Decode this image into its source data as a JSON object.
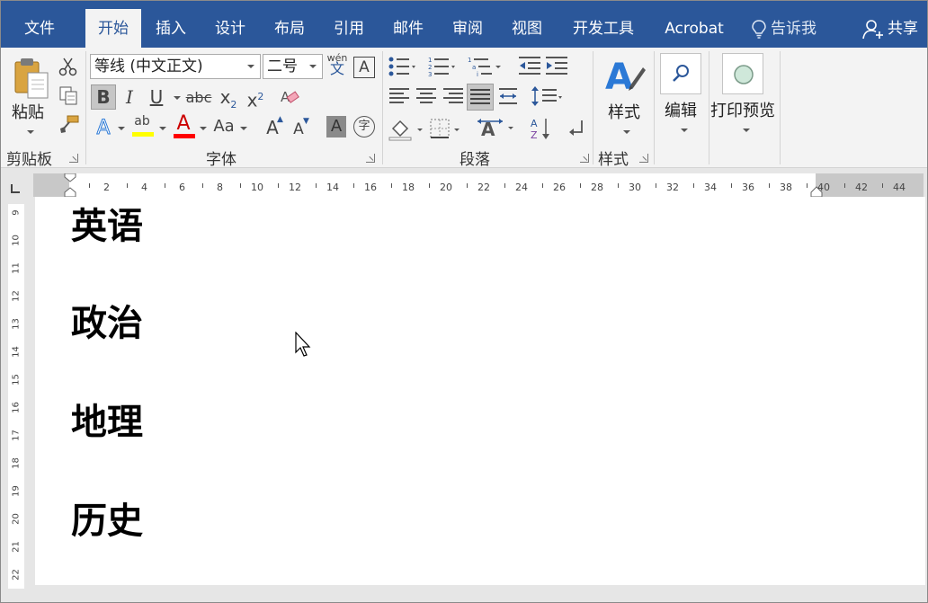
{
  "tabs": [
    {
      "label": "文件",
      "active": false
    },
    {
      "label": "开始",
      "active": true
    },
    {
      "label": "插入",
      "active": false
    },
    {
      "label": "设计",
      "active": false
    },
    {
      "label": "布局",
      "active": false
    },
    {
      "label": "引用",
      "active": false
    },
    {
      "label": "邮件",
      "active": false
    },
    {
      "label": "审阅",
      "active": false
    },
    {
      "label": "视图",
      "active": false
    },
    {
      "label": "开发工具",
      "active": false
    },
    {
      "label": "Acrobat",
      "active": false
    }
  ],
  "tell_me": "告诉我",
  "share": "共享",
  "clipboard": {
    "paste_label": "粘贴",
    "group_label": "剪贴板"
  },
  "font": {
    "font_name": "等线 (中文正文)",
    "font_size": "二号",
    "phonetic_top": "wén",
    "phonetic_bottom": "文",
    "border_char": "A",
    "bold": "B",
    "italic": "I",
    "underline": "U",
    "strikethrough": "abc",
    "subscript": "x",
    "sub_small": "2",
    "superscript": "x",
    "super_small": "2",
    "text_effects": "A",
    "highlight_text": "ab",
    "font_color": "A",
    "change_case": "Aa",
    "grow": "A",
    "shrink": "A",
    "char_shading": "A",
    "enclose": "字",
    "group_label": "字体"
  },
  "paragraph": {
    "group_label": "段落"
  },
  "styles": {
    "label": "样式",
    "group_label": "样式"
  },
  "editing": {
    "label": "编辑"
  },
  "print_preview": {
    "label": "打印预览"
  },
  "ruler": {
    "h_ticks": [
      "2",
      "4",
      "6",
      "8",
      "10",
      "12",
      "14",
      "16",
      "18",
      "20",
      "22",
      "24",
      "26",
      "28",
      "30",
      "32",
      "34",
      "36",
      "38",
      "40",
      "42",
      "44"
    ],
    "v_ticks": [
      "9",
      "10",
      "11",
      "12",
      "13",
      "14",
      "15",
      "16",
      "17",
      "18",
      "19",
      "20",
      "21",
      "22"
    ]
  },
  "document": {
    "headings": [
      "英语",
      "政治",
      "地理",
      "历史"
    ]
  },
  "colors": {
    "ribbon_blue": "#2b579a",
    "highlight_yellow": "#ffff00",
    "font_red": "#ff0000"
  }
}
